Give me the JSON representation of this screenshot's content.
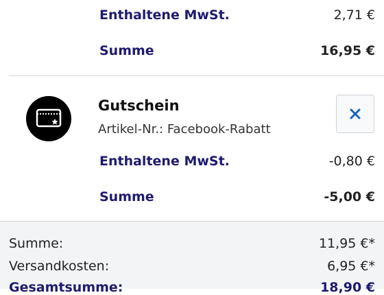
{
  "item1": {
    "tax_label": "Enthaltene MwSt.",
    "tax_value": "2,71 €",
    "sum_label": "Summe",
    "sum_value": "16,95 €"
  },
  "coupon": {
    "icon": "coupon-card-icon",
    "title": "Gutschein",
    "article_no": "Artikel-Nr.: Facebook-Rabatt",
    "remove_icon": "close-icon",
    "tax_label": "Enthaltene MwSt.",
    "tax_value": "-0,80 €",
    "sum_label": "Summe",
    "sum_value": "-5,00 €"
  },
  "totals": {
    "subtotal_label": "Summe:",
    "subtotal_value": "11,95 €*",
    "shipping_label": "Versandkosten:",
    "shipping_value": "6,95 €*",
    "grand_total_label": "Gesamtsumme:",
    "grand_total_value": "18,90 €"
  },
  "colors": {
    "accent": "#1f1b6e",
    "close": "#1565c0"
  }
}
